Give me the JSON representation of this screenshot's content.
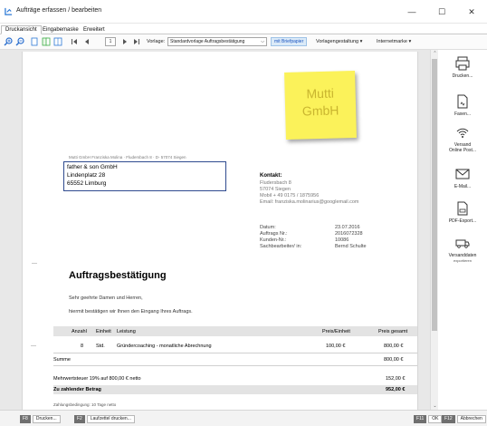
{
  "window": {
    "title": "Aufträge erfassen / bearbeiten",
    "minimize": "—",
    "maximize": "☐",
    "close": "✕"
  },
  "tabs": [
    "Druckansicht",
    "Eingabemaske",
    "Erweitert"
  ],
  "toolbar": {
    "page_number": "1",
    "template_label": "Vorlage:",
    "template_value": "Standardvorlage Auftragsbestätigung",
    "letterhead_button": "mit Briefpapier",
    "template_design": "Vorlagengestaltung",
    "internet_marker": "Internetmarke"
  },
  "document": {
    "sticky_note": [
      "Mutti",
      "GmbH"
    ],
    "sender_line": "Mutti GmbH Franziska Molina · Fludersbach 8 · D- 57074 Siegen",
    "recipient": [
      "father & son GmbH",
      "Lindenplatz 28",
      "65552 Limburg"
    ],
    "contact": {
      "heading": "Kontakt:",
      "lines": [
        "Fludersbach 8",
        "57074 Siegen",
        "Mobil + 49 0175 / 1875956",
        "Email: franziska.molinarius@googlemail.com"
      ]
    },
    "meta": [
      {
        "label": "Datum:",
        "value": "23.07.2016"
      },
      {
        "label": "Auftrags Nr.:",
        "value": "2016072328"
      },
      {
        "label": "Kunden-Nr.:",
        "value": "10086"
      },
      {
        "label": "Sachbearbeiter/ in:",
        "value": "Bernd Schulte"
      }
    ],
    "heading": "Auftragsbestätigung",
    "greeting": "Sehr geehrte Damen und Herren,",
    "intro": "hiermit bestätigen wir Ihnen den Eingang Ihres Auftrags.",
    "table": {
      "headers": [
        "Anzahl",
        "Einheit",
        "Leistung",
        "Preis/Einheit",
        "Preis gesamt"
      ],
      "rows": [
        {
          "qty": "8",
          "unit": "Std.",
          "service": "Gründercoaching - monatliche Abrechnung",
          "unit_price": "100,00 €",
          "total": "800,00 €"
        }
      ],
      "sum_label": "Summe",
      "sum_value": "800,00 €",
      "tax_label": "Mehrwertsteuer 19% auf 800,00 € netto",
      "tax_value": "152,00 €",
      "total_label": "Zu zahlender Betrag",
      "total_value": "952,00 €"
    },
    "payment_terms": "Zahlungsbedingung: 10 Tage netto",
    "margin_dash_1": "—",
    "margin_dash_2": "—"
  },
  "side_actions": [
    {
      "label": "Drucken...",
      "sub": "",
      "icon": "printer-icon"
    },
    {
      "label": "Faxen...",
      "sub": "",
      "icon": "fax-icon"
    },
    {
      "label": "Versand",
      "sub": "Online Post...",
      "icon": "online-post-icon"
    },
    {
      "label": "E-Mail...",
      "sub": "",
      "icon": "mail-icon"
    },
    {
      "label": "PDF-Export...",
      "sub": "",
      "icon": "pdf-icon"
    },
    {
      "label": "Versanddaten",
      "sub": "exportieren",
      "icon": "truck-icon"
    }
  ],
  "statusbar": {
    "f8_key": "F8",
    "f8_label": "Drucken...",
    "f2_key": "F2",
    "f2_label": "Laufzettel drucken...",
    "f11_key": "F11",
    "f11_label": "OK",
    "f12_key": "F12",
    "f12_label": "Abbrechen"
  },
  "colors": {
    "accent": "#1a55c0",
    "sticky": "#fbf25a",
    "sticky_text": "#c9b52f",
    "address_border": "#2f4a8f"
  }
}
